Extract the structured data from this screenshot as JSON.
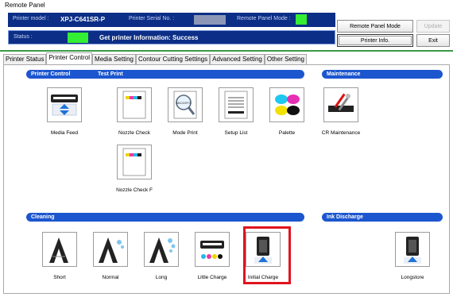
{
  "window_title": "Remote Panel",
  "header": {
    "printer_model_label": "Printer model :",
    "printer_model_value": "XPJ-C641SR-P",
    "serial_label": "Printer Serial No. :",
    "remote_mode_label": "Remote Panel Mode :",
    "status_label": "Status :",
    "status_message": "Get printer Information: Success",
    "status_color": "#33ee33"
  },
  "buttons": {
    "remote_panel_mode": "Remote Panel Mode",
    "update": "Update",
    "printer_info": "Printer Info.",
    "exit": "Exit"
  },
  "tabs": [
    "Printer Status",
    "Printer Control",
    "Media Setting",
    "Contour Cutting Settings",
    "Advanced Setting",
    "Other Setting"
  ],
  "active_tab": "Printer Control",
  "sections": {
    "printer_control": "Printer Control",
    "test_print": "Test Print",
    "maintenance": "Maintenance",
    "cleaning": "Cleaning",
    "ink_discharge": "Ink Discharge"
  },
  "tiles": {
    "media_feed": "Media Feed",
    "nozzle_check": "Nozzle Check",
    "mode_print": "Mode Print",
    "setup_list": "Setup List",
    "palette": "Palette",
    "cr_maintenance": "CR Maintenance",
    "nozzle_check_f": "Nozzle Check F",
    "short": "Short",
    "normal": "Normal",
    "long": "Long",
    "little_charge": "Little Charge",
    "initial_charge": "Initial Charge",
    "longstore": "Longstore"
  },
  "icons": {
    "mode_print_badge": "ABCDEFG"
  },
  "colors": {
    "header_bg": "#0c2e86",
    "section_blue": "#1c56cf",
    "highlight_red": "#e0141f"
  }
}
